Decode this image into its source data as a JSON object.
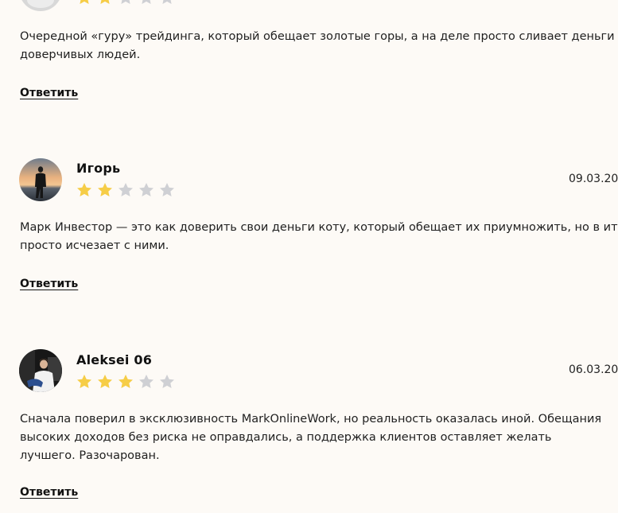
{
  "colors": {
    "background": "#fdfaf6",
    "star_filled": "#f6cd47",
    "star_empty": "#cfd0d4"
  },
  "reviews": [
    {
      "author": "",
      "date": "",
      "rating": 2,
      "text": "Очередной «гуру» трейдинга, который обещает золотые горы, а на деле просто сливает деньги доверчивых людей.",
      "reply_label": "Ответить"
    },
    {
      "author": "Игорь",
      "date": "09.03.20",
      "rating": 2,
      "text": "Марк Инвестор — это как доверить свои деньги коту, который обещает их приумножить, но в итоге просто исчезает с ними.",
      "reply_label": "Ответить",
      "avatar_icon": "user-photo-sunset-icon"
    },
    {
      "author": "Aleksei 06",
      "date": "06.03.20",
      "rating": 3,
      "text": "Сначала поверил в эксклюзивность MarkOnlineWork, но реальность оказалась иной. Обещания высоких доходов без риска не оправдались, а поддержка клиентов оставляет желать лучшего. Разочарован.",
      "reply_label": "Ответить",
      "avatar_icon": "user-photo-dark-icon"
    }
  ]
}
